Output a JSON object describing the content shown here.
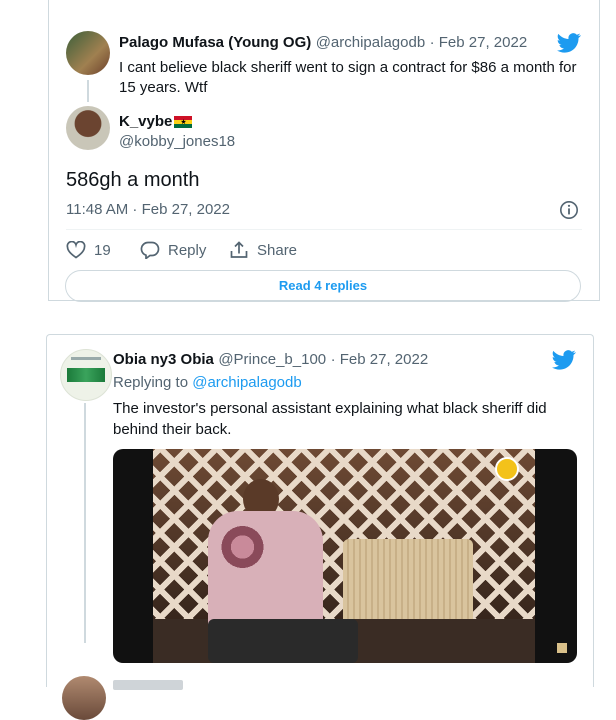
{
  "tweet1": {
    "quoted": {
      "name": "Palago Mufasa (Young OG)",
      "handle": "@archipalagodb",
      "date": "· Feb 27, 2022",
      "text_line1": "I cant believe black sheriff went to sign a contract for $86 a month for",
      "text_line2": "15 years. Wtf"
    },
    "reply": {
      "name": "K_vybe",
      "flag": "ghana-flag-icon",
      "handle": "@kobby_jones18",
      "text": "586gh a month",
      "timestamp": "11:48 AM · Feb 27, 2022"
    },
    "actions": {
      "like_count": "19",
      "reply_label": "Reply",
      "share_label": "Share"
    },
    "read_replies_label": "Read 4 replies"
  },
  "tweet2": {
    "name": "Obia ny3 Obia",
    "handle": "@Prince_b_100",
    "date": "· Feb 27, 2022",
    "replying_to_prefix": "Replying to ",
    "replying_to_handle": "@archipalagodb",
    "text_line1": "The investor's personal assistant explaining what black sheriff did",
    "text_line2": "behind their back."
  },
  "colors": {
    "twitter_blue": "#1d9bf0",
    "text_secondary": "#536471",
    "border": "#cfd9de"
  }
}
